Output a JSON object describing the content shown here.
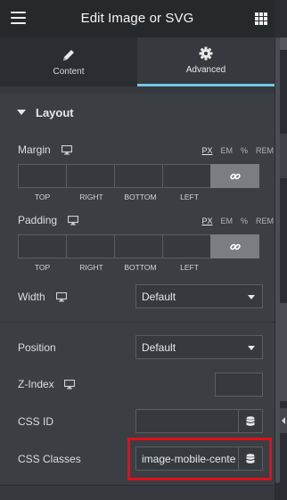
{
  "header": {
    "title": "Edit Image or SVG"
  },
  "tabs": [
    {
      "label": "Content",
      "icon": "pencil-icon"
    },
    {
      "label": "Advanced",
      "icon": "gear-icon"
    }
  ],
  "section": {
    "title": "Layout"
  },
  "margin": {
    "label": "Margin",
    "units": [
      "PX",
      "EM",
      "%",
      "REM"
    ],
    "sides": [
      "TOP",
      "RIGHT",
      "BOTTOM",
      "LEFT"
    ]
  },
  "padding": {
    "label": "Padding",
    "units": [
      "PX",
      "EM",
      "%",
      "REM"
    ],
    "sides": [
      "TOP",
      "RIGHT",
      "BOTTOM",
      "LEFT"
    ]
  },
  "width": {
    "label": "Width",
    "value": "Default"
  },
  "position": {
    "label": "Position",
    "value": "Default"
  },
  "zindex": {
    "label": "Z-Index",
    "value": ""
  },
  "cssid": {
    "label": "CSS ID",
    "value": ""
  },
  "cssclasses": {
    "label": "CSS Classes",
    "value": "image-mobile-cente"
  },
  "colors": {
    "accent": "#72c7e5",
    "highlight": "#e0101b"
  }
}
